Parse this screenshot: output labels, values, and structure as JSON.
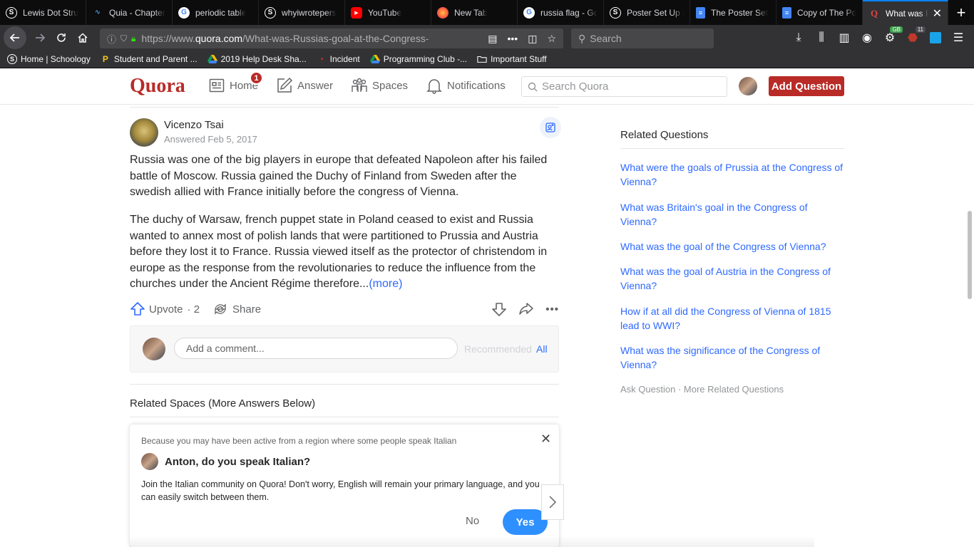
{
  "browser": {
    "tabs": [
      {
        "label": "Lewis Dot Stru",
        "icon": "schoology-icon",
        "color": "#ffffff"
      },
      {
        "label": "Quia - Chapter",
        "icon": "quia-icon",
        "color": "#4a90d9"
      },
      {
        "label": "periodic table",
        "icon": "google-icon",
        "color": "#ffffff"
      },
      {
        "label": "whyiwrotepers",
        "icon": "schoology-icon",
        "color": "#ffffff"
      },
      {
        "label": "YouTube",
        "icon": "youtube-icon",
        "color": "#ff0000"
      },
      {
        "label": "New Tab",
        "icon": "firefox-icon",
        "color": "#ff9500"
      },
      {
        "label": "russia flag - Go",
        "icon": "google-icon",
        "color": "#ffffff"
      },
      {
        "label": "Poster Set Up |",
        "icon": "schoology-icon",
        "color": "#ffffff"
      },
      {
        "label": "The Poster Set",
        "icon": "docs-icon",
        "color": "#4285f4"
      },
      {
        "label": "Copy of The Po",
        "icon": "docs-icon",
        "color": "#4285f4"
      },
      {
        "label": "What was R",
        "icon": "quora-icon",
        "color": "#b92b27",
        "active": true
      }
    ],
    "url_prefix": "https://www.",
    "url_host": "quora.com",
    "url_path": "/What-was-Russias-goal-at-the-Congress-",
    "search_placeholder": "Search",
    "ext_badge_green": "GB",
    "ext_badge_red": "11",
    "bookmarks": [
      {
        "label": "Home | Schoology",
        "icon": "schoology-icon"
      },
      {
        "label": "Student and Parent ...",
        "icon": "p-icon"
      },
      {
        "label": "2019 Help Desk Sha...",
        "icon": "drive-icon"
      },
      {
        "label": "Incident",
        "icon": "incident-icon"
      },
      {
        "label": "Programming Club -...",
        "icon": "drive-icon"
      },
      {
        "label": "Important Stuff",
        "icon": "folder-icon"
      }
    ]
  },
  "quora": {
    "logo": "Quora",
    "nav": {
      "home": "Home",
      "home_badge": "1",
      "answer": "Answer",
      "spaces": "Spaces",
      "notifications": "Notifications"
    },
    "search_placeholder": "Search Quora",
    "add_question": "Add Question",
    "brand_color": "#b92b27",
    "link_color": "#2e69ff"
  },
  "answer": {
    "author": "Vicenzo Tsai",
    "answered": "Answered Feb 5, 2017",
    "paragraph1": "Russia was one of the big players in europe that defeated Napoleon after his failed battle of Moscow. Russia gained the Duchy of Finland from Sweden after the swedish allied with France initially before the congress of Vienna.",
    "paragraph2": "The duchy of Warsaw, french puppet state in Poland ceased to exist and Russia wanted to annex most of polish lands that were partitioned to Prussia and Austria before they lost it to France. Russia viewed itself as the protector of christendom in europe as the response from the revolutionaries to reduce the influence from the churches under the Ancient Régime therefore...",
    "more": "(more)",
    "upvote": "Upvote",
    "upvote_count": "· 2",
    "share": "Share",
    "comment_placeholder": "Add a comment...",
    "recommended": "Recommended",
    "all": "All"
  },
  "related_spaces": "Related Spaces (More Answers Below)",
  "popup": {
    "note": "Because you may have been active from a region where some people speak Italian",
    "title": "Anton, do you speak Italian?",
    "body": "Join the Italian community on Quora! Don't worry, English will remain your primary language, and you can easily switch between them.",
    "no": "No",
    "yes": "Yes"
  },
  "sidebar": {
    "title": "Related Questions",
    "questions": [
      "What were the goals of Prussia at the Congress of Vienna?",
      "What was Britain's goal in the Congress of Vienna?",
      "What was the goal of the Congress of Vienna?",
      "What was the goal of Austria in the Congress of Vienna?",
      "How if at all did the Congress of Vienna of 1815 lead to WWI?",
      "What was the significance of the Congress of Vienna?"
    ],
    "ask_question": "Ask Question",
    "more_related": "More Related Questions",
    "footer_sep": " · "
  }
}
